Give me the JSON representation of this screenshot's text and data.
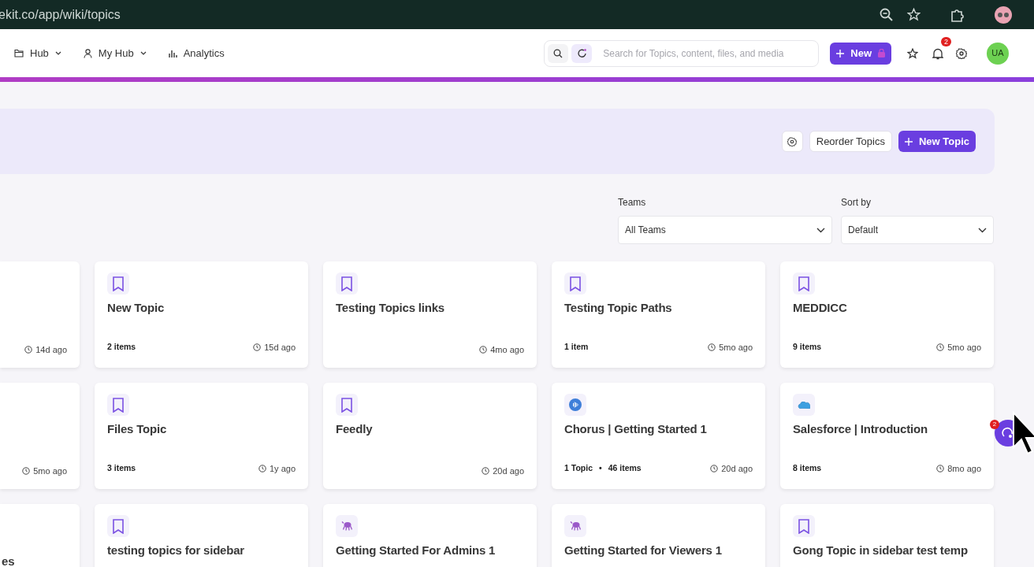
{
  "browser": {
    "url": "ekit.co/app/wiki/topics"
  },
  "nav": [
    {
      "label": "Hub",
      "kind": "folder",
      "dropdown": true
    },
    {
      "label": "My Hub",
      "kind": "person",
      "dropdown": true
    },
    {
      "label": "Analytics",
      "kind": "chart",
      "dropdown": false
    }
  ],
  "search": {
    "placeholder": "Search for Topics, content, files, and media"
  },
  "new_button": {
    "label": "New"
  },
  "notifications": {
    "count": "2"
  },
  "avatar": {
    "initials": "UA"
  },
  "toolbar": {
    "reorder": "Reorder Topics",
    "new_topic": "New Topic"
  },
  "filters": [
    {
      "label": "Teams",
      "value": "All Teams"
    },
    {
      "label": "Sort by",
      "value": "Default"
    }
  ],
  "cards": [
    {
      "kind": "partial",
      "time": "14d ago"
    },
    {
      "kind": "bookmark",
      "title": "New Topic",
      "meta": [
        "2 items"
      ],
      "time": "15d ago"
    },
    {
      "kind": "bookmark",
      "title": "Testing Topics links",
      "time": "4mo ago"
    },
    {
      "kind": "bookmark",
      "title": "Testing Topic Paths",
      "meta": [
        "1 item"
      ],
      "time": "5mo ago"
    },
    {
      "kind": "bookmark",
      "title": "MEDDICC",
      "meta": [
        "9 items"
      ],
      "time": "5mo ago"
    },
    {
      "kind": "partial",
      "time": "5mo ago"
    },
    {
      "kind": "bookmark",
      "title": "Files Topic",
      "meta": [
        "3 items"
      ],
      "time": "1y ago"
    },
    {
      "kind": "bookmark",
      "title": "Feedly",
      "time": "20d ago"
    },
    {
      "kind": "waveform",
      "title": "Chorus | Getting Started 1",
      "meta": [
        "1 Topic",
        "46 items"
      ],
      "meta_separator": "•",
      "time": "20d ago"
    },
    {
      "kind": "cloud",
      "title": "Salesforce | Introduction",
      "meta": [
        "8 items"
      ],
      "time": "8mo ago"
    },
    {
      "kind": "partial",
      "title": "es"
    },
    {
      "kind": "bookmark",
      "title": "testing topics for sidebar"
    },
    {
      "kind": "octopus",
      "title": "Getting Started For Admins 1"
    },
    {
      "kind": "octopus",
      "title": "Getting Started for Viewers 1"
    },
    {
      "kind": "bookmark",
      "title": "Gong Topic in sidebar test temp"
    }
  ],
  "chat_widget": {
    "badge": "2"
  }
}
